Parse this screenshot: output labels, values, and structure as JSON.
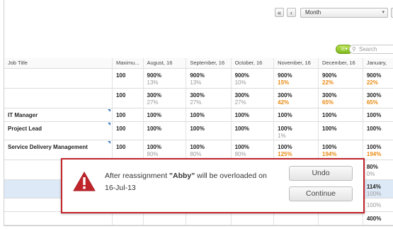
{
  "toolbar": {
    "prev_label": "«",
    "back_label": "‹",
    "period_select_value": "Month",
    "search_placeholder": "Search"
  },
  "table": {
    "columns": [
      "Job Title",
      "Maximu...",
      "August, 16",
      "September, 16",
      "October, 16",
      "November, 16",
      "December, 16",
      "January,"
    ],
    "rows": [
      {
        "job": "",
        "max": "100",
        "cells": [
          [
            "900%",
            "13%",
            false
          ],
          [
            "900%",
            "13%",
            false
          ],
          [
            "900%",
            "10%",
            false
          ],
          [
            "900%",
            "15%",
            true
          ],
          [
            "900%",
            "22%",
            true
          ],
          [
            "900%",
            "22%",
            true
          ]
        ]
      },
      {
        "job": "",
        "max": "100",
        "cells": [
          [
            "300%",
            "27%",
            false
          ],
          [
            "300%",
            "27%",
            false
          ],
          [
            "300%",
            "27%",
            false
          ],
          [
            "300%",
            "42%",
            true
          ],
          [
            "300%",
            "65%",
            true
          ],
          [
            "300%",
            "65%",
            true
          ]
        ]
      },
      {
        "job": "IT Manager",
        "max": "100",
        "cells": [
          [
            "100%",
            "",
            false
          ],
          [
            "100%",
            "",
            false
          ],
          [
            "100%",
            "",
            false
          ],
          [
            "100%",
            "",
            false
          ],
          [
            "100%",
            "",
            false
          ],
          [
            "100%",
            "",
            false
          ]
        ]
      },
      {
        "job": "Project Lead",
        "max": "100",
        "cells": [
          [
            "100%",
            "",
            false
          ],
          [
            "100%",
            "",
            false
          ],
          [
            "100%",
            "",
            false
          ],
          [
            "100%",
            "1%",
            false
          ],
          [
            "100%",
            "",
            false
          ],
          [
            "100%",
            "",
            false
          ]
        ]
      },
      {
        "job": "Service Delivery Management",
        "max": "100",
        "cells": [
          [
            "100%",
            "80%",
            false
          ],
          [
            "100%",
            "80%",
            false
          ],
          [
            "100%",
            "80%",
            false
          ],
          [
            "100%",
            "125%",
            true
          ],
          [
            "100%",
            "194%",
            true
          ],
          [
            "100%",
            "194%",
            true
          ]
        ]
      },
      {
        "job": "",
        "max": "",
        "cells": [
          [
            "",
            "",
            false
          ],
          [
            "",
            "",
            false
          ],
          [
            "",
            "",
            false
          ],
          [
            "",
            "",
            false
          ],
          [
            "",
            "",
            false
          ],
          [
            "80%",
            "0%",
            false
          ]
        ]
      },
      {
        "job": "",
        "max": "",
        "cells": [
          [
            "",
            "",
            false
          ],
          [
            "",
            "",
            false
          ],
          [
            "",
            "",
            false
          ],
          [
            "",
            "",
            false
          ],
          [
            "",
            "",
            false
          ],
          [
            "114%",
            "100%",
            false
          ]
        ]
      },
      {
        "job": "",
        "max": "",
        "cells": [
          [
            "",
            "",
            false
          ],
          [
            "",
            "",
            false
          ],
          [
            "",
            "",
            false
          ],
          [
            "",
            "",
            false
          ],
          [
            "",
            "",
            false
          ],
          [
            "",
            "100%",
            false
          ]
        ]
      },
      {
        "job": "",
        "max": "",
        "cells": [
          [
            "",
            "",
            false
          ],
          [
            "",
            "",
            false
          ],
          [
            "",
            "",
            false
          ],
          [
            "",
            "",
            false
          ],
          [
            "",
            "",
            false
          ],
          [
            "400%",
            "",
            false
          ]
        ]
      }
    ]
  },
  "dialog": {
    "message_prefix": "After reassignment ",
    "resource_name": "\"Abby\"",
    "message_suffix": " will be overloaded on",
    "message_date": "16-Jul-13",
    "undo_label": "Undo",
    "continue_label": "Continue",
    "icon": "warning-triangle-icon",
    "accent_color": "#c0242b"
  },
  "colors": {
    "warning_text": "#e88a12",
    "highlight_row": "#dde9f6",
    "filter_button": "#8cc63f"
  }
}
